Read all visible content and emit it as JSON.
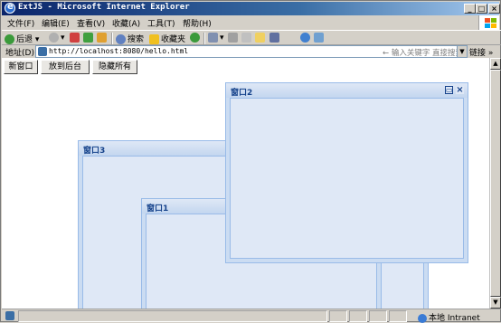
{
  "window": {
    "title": "ExtJS - Microsoft Internet Explorer",
    "min_label": "_",
    "max_label": "□",
    "close_label": "×"
  },
  "menu": [
    "文件(F)",
    "编辑(E)",
    "查看(V)",
    "收藏(A)",
    "工具(T)",
    "帮助(H)"
  ],
  "toolbar": {
    "back": "后退",
    "search": "搜索",
    "favorites": "收藏夹"
  },
  "address": {
    "label": "地址(D)",
    "url": "http://localhost:8080/hello.html",
    "search_placeholder": "← 输入关键字 直接搜索",
    "links": "链接 »"
  },
  "buttons": {
    "new_window": "新窗口",
    "send_back": "放到后台",
    "hide_all": "隐藏所有"
  },
  "windows": {
    "w1": "窗口1",
    "w2": "窗口2",
    "w3": "窗口3"
  },
  "status": {
    "zone": "本地 Intranet"
  },
  "colors": {
    "titlebar": "#0a246a",
    "ext_window_border": "#99bbe8",
    "ext_header_text": "#15428b"
  }
}
